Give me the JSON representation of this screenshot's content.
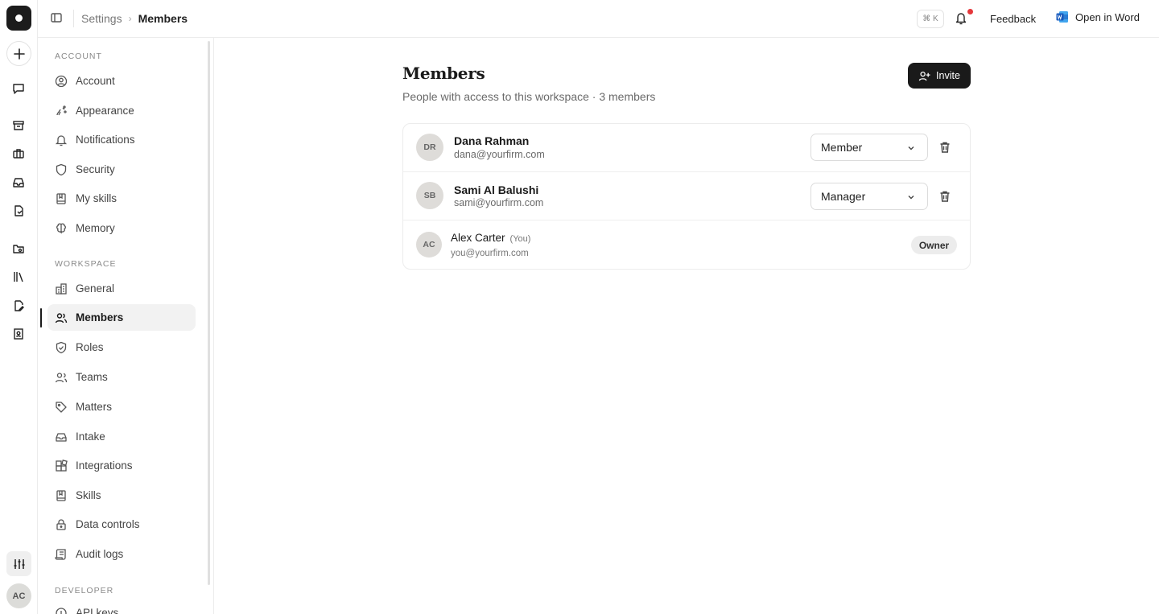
{
  "rail": {
    "avatar_initials": "AC",
    "icons": [
      "chat-icon",
      "archive-icon",
      "briefcase-icon",
      "inbox-icon",
      "document-icon",
      "folder-icon",
      "library-icon",
      "edit-doc-icon",
      "id-badge-icon"
    ]
  },
  "topbar": {
    "breadcrumb_settings": "Settings",
    "breadcrumb_sep": "›",
    "breadcrumb_current": "Members",
    "shortcut": "⌘ K",
    "feedback_label": "Feedback",
    "open_word_label": "Open in Word",
    "notification_dot_color": "#e5383b"
  },
  "sidebar": {
    "account_header": "ACCOUNT",
    "account_items": [
      {
        "label": "Account",
        "icon": "user-circle-icon"
      },
      {
        "label": "Appearance",
        "icon": "palette-icon"
      },
      {
        "label": "Notifications",
        "icon": "bell-icon"
      },
      {
        "label": "Security",
        "icon": "shield-icon"
      },
      {
        "label": "My skills",
        "icon": "bookmark-icon"
      },
      {
        "label": "Memory",
        "icon": "brain-icon"
      }
    ],
    "workspace_header": "WORKSPACE",
    "workspace_items": [
      {
        "label": "General",
        "icon": "building-icon"
      },
      {
        "label": "Members",
        "icon": "users-icon",
        "active": true
      },
      {
        "label": "Roles",
        "icon": "shield-check-icon"
      },
      {
        "label": "Teams",
        "icon": "team-icon"
      },
      {
        "label": "Matters",
        "icon": "tag-icon"
      },
      {
        "label": "Intake",
        "icon": "inbox-icon"
      },
      {
        "label": "Integrations",
        "icon": "blocks-icon"
      },
      {
        "label": "Skills",
        "icon": "bookmark-icon"
      },
      {
        "label": "Data controls",
        "icon": "lock-icon"
      },
      {
        "label": "Audit logs",
        "icon": "scroll-icon"
      }
    ],
    "developer_header": "DEVELOPER",
    "developer_items": [
      {
        "label": "API keys",
        "icon": "key-icon"
      }
    ]
  },
  "main": {
    "title": "Members",
    "subtitle": "People with access to this workspace · 3 members",
    "invite_label": "Invite",
    "members": [
      {
        "initials": "DR",
        "name": "Dana Rahman",
        "email": "dana@yourfirm.com",
        "role": "Member"
      },
      {
        "initials": "SB",
        "name": "Sami Al Balushi",
        "email": "sami@yourfirm.com",
        "role": "Manager"
      },
      {
        "initials": "AC",
        "name": "Alex Carter",
        "you_tag": "(You)",
        "email": "you@yourfirm.com",
        "role_badge": "Owner"
      }
    ]
  }
}
